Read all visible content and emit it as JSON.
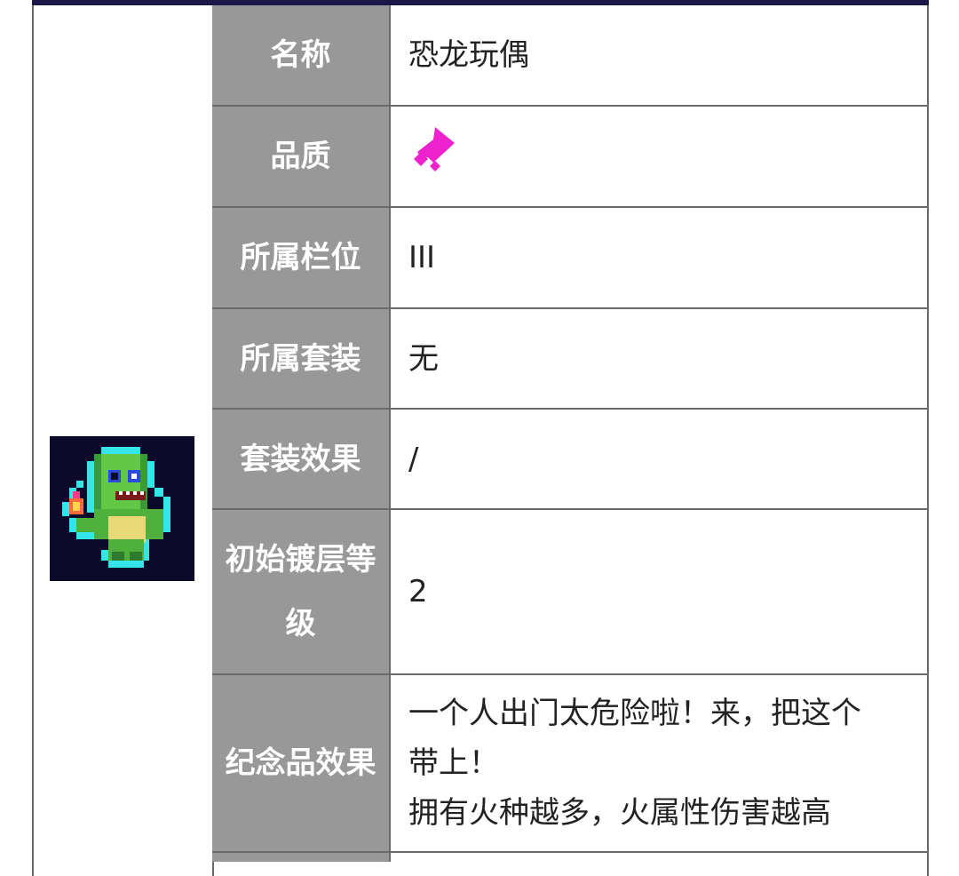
{
  "table": {
    "rows": [
      {
        "label": "名称",
        "value": "恐龙玩偶"
      },
      {
        "label": "品质",
        "value": ""
      },
      {
        "label": "所属栏位",
        "value": "III"
      },
      {
        "label": "所属套装",
        "value": "无"
      },
      {
        "label": "套装效果",
        "value": "/"
      },
      {
        "label": "初始镀层等级",
        "value": "2"
      },
      {
        "label": "纪念品效果",
        "value_lines": [
          "一个人出门太危险啦！来，把这个",
          "带上！",
          "拥有火种越多，火属性伤害越高"
        ]
      }
    ]
  },
  "icons": {
    "item": "dinosaur-plush-icon",
    "quality": "magenta-quality-gem-icon"
  },
  "colors": {
    "label_bg": "#989898",
    "quality": "#ee22cc",
    "icon_bg": "#0c0a2a"
  }
}
